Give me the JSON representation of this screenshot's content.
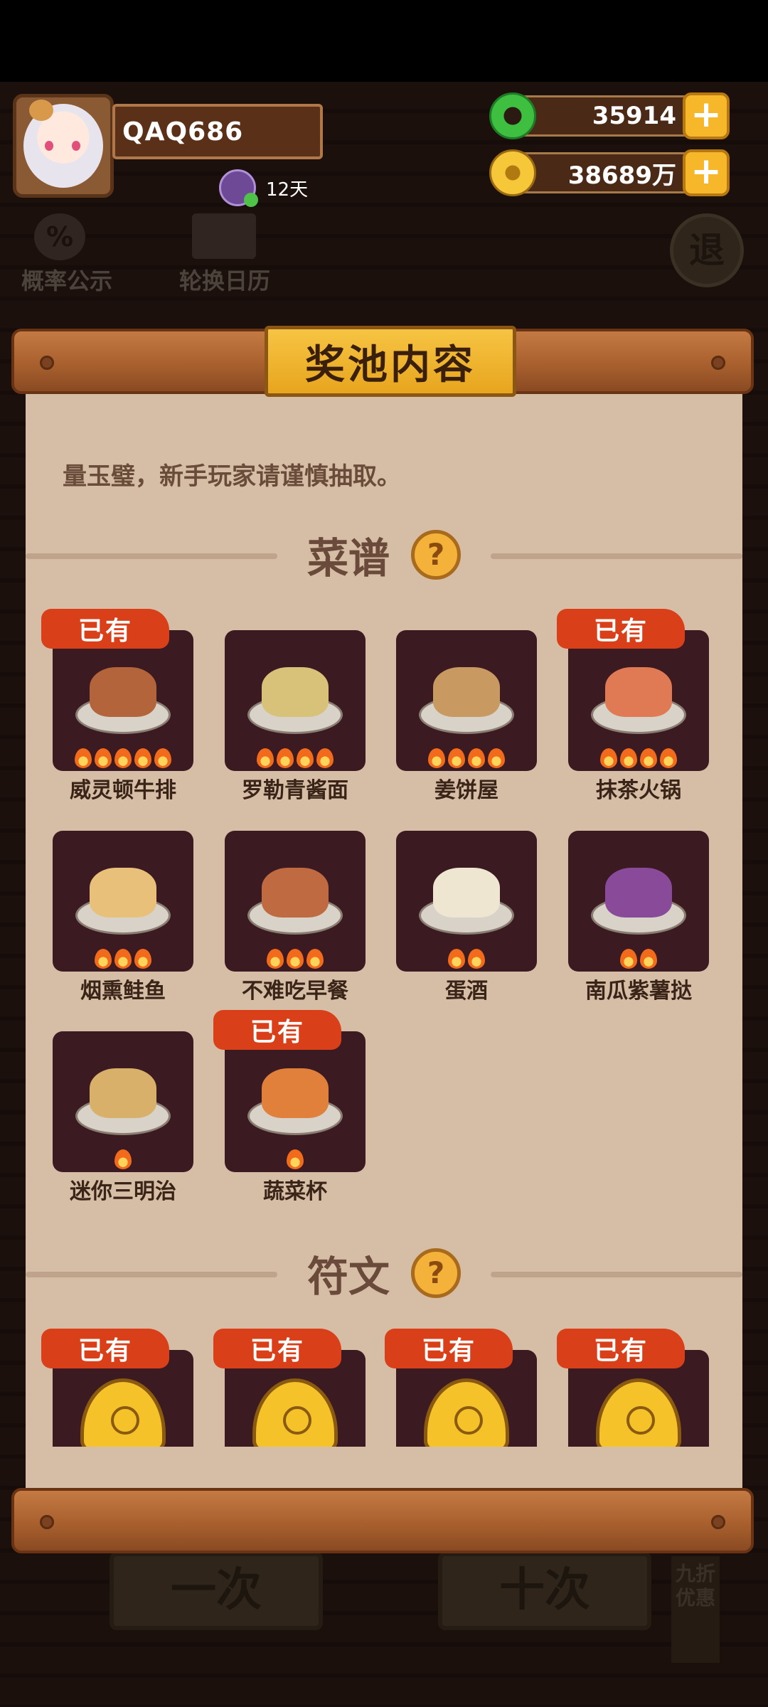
{
  "header": {
    "username": "QAQ686",
    "vip_days": "12天",
    "jade_amount": "35914",
    "coin_amount": "38689万",
    "plus_symbol": "+"
  },
  "background": {
    "prob_label": "概率公示",
    "calendar_label": "轮换日历",
    "exit_label": "退",
    "bottom_btn_1": "一次",
    "bottom_btn_2": "十次",
    "discount_label": "九折优惠"
  },
  "panel": {
    "title": "奖池内容",
    "intro_text": "量玉璧，新手玩家请谨慎抽取。",
    "owned_label": "已有",
    "recipes": {
      "title": "菜谱",
      "items": [
        {
          "name": "威灵顿牛排",
          "owned": true,
          "stars": 5,
          "food_color": "#b4643a"
        },
        {
          "name": "罗勒青酱面",
          "owned": false,
          "stars": 4,
          "food_color": "#d8c27a"
        },
        {
          "name": "姜饼屋",
          "owned": false,
          "stars": 4,
          "food_color": "#c89a62"
        },
        {
          "name": "抹茶火锅",
          "owned": true,
          "stars": 4,
          "food_color": "#e07a54"
        },
        {
          "name": "烟熏鲑鱼",
          "owned": false,
          "stars": 3,
          "food_color": "#e8c07a"
        },
        {
          "name": "不难吃早餐",
          "owned": false,
          "stars": 3,
          "food_color": "#c06a42"
        },
        {
          "name": "蛋酒",
          "owned": false,
          "stars": 2,
          "food_color": "#efe6d2"
        },
        {
          "name": "南瓜紫薯挞",
          "owned": false,
          "stars": 2,
          "food_color": "#8a4a9a"
        },
        {
          "name": "迷你三明治",
          "owned": false,
          "stars": 1,
          "food_color": "#d8b06a"
        },
        {
          "name": "蔬菜杯",
          "owned": true,
          "stars": 1,
          "food_color": "#e0803a"
        }
      ]
    },
    "runes": {
      "title": "符文",
      "items": [
        {
          "owned": true
        },
        {
          "owned": true
        },
        {
          "owned": true
        },
        {
          "owned": true
        }
      ]
    },
    "help_symbol": "?"
  }
}
